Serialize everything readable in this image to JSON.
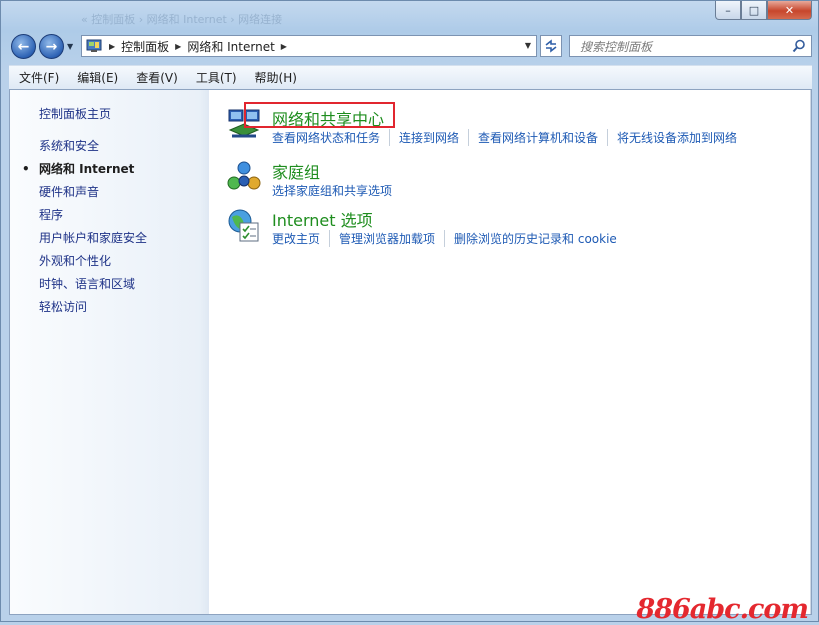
{
  "window": {
    "ghost_title": "« 控制面板 › 网络和 Internet › 网络连接",
    "caption_buttons": {
      "minimize": "–",
      "maximize": "□",
      "close": "✕"
    }
  },
  "nav": {
    "back": "←",
    "forward": "→",
    "breadcrumbs": [
      "控制面板",
      "网络和 Internet"
    ],
    "search_placeholder": "搜索控制面板"
  },
  "menu": [
    "文件(F)",
    "编辑(E)",
    "查看(V)",
    "工具(T)",
    "帮助(H)"
  ],
  "left_pane": {
    "home": "控制面板主页",
    "items": [
      {
        "label": "系统和安全",
        "active": false
      },
      {
        "label": "网络和 Internet",
        "active": true
      },
      {
        "label": "硬件和声音",
        "active": false
      },
      {
        "label": "程序",
        "active": false
      },
      {
        "label": "用户帐户和家庭安全",
        "active": false
      },
      {
        "label": "外观和个性化",
        "active": false
      },
      {
        "label": "时钟、语言和区域",
        "active": false
      },
      {
        "label": "轻松访问",
        "active": false
      }
    ]
  },
  "categories": [
    {
      "title": "网络和共享中心",
      "icon": "network-sharing-center-icon",
      "links": [
        "查看网络状态和任务",
        "连接到网络",
        "查看网络计算机和设备",
        "将无线设备添加到网络"
      ]
    },
    {
      "title": "家庭组",
      "icon": "homegroup-icon",
      "links": [
        "选择家庭组和共享选项"
      ]
    },
    {
      "title": "Internet 选项",
      "icon": "internet-options-icon",
      "links": [
        "更改主页",
        "管理浏览器加载项",
        "删除浏览的历史记录和 cookie"
      ]
    }
  ],
  "watermark": "886abc.com",
  "colors": {
    "link": "#1e5ab4",
    "category_title": "#1e8d1e",
    "highlight": "#e1262f"
  }
}
